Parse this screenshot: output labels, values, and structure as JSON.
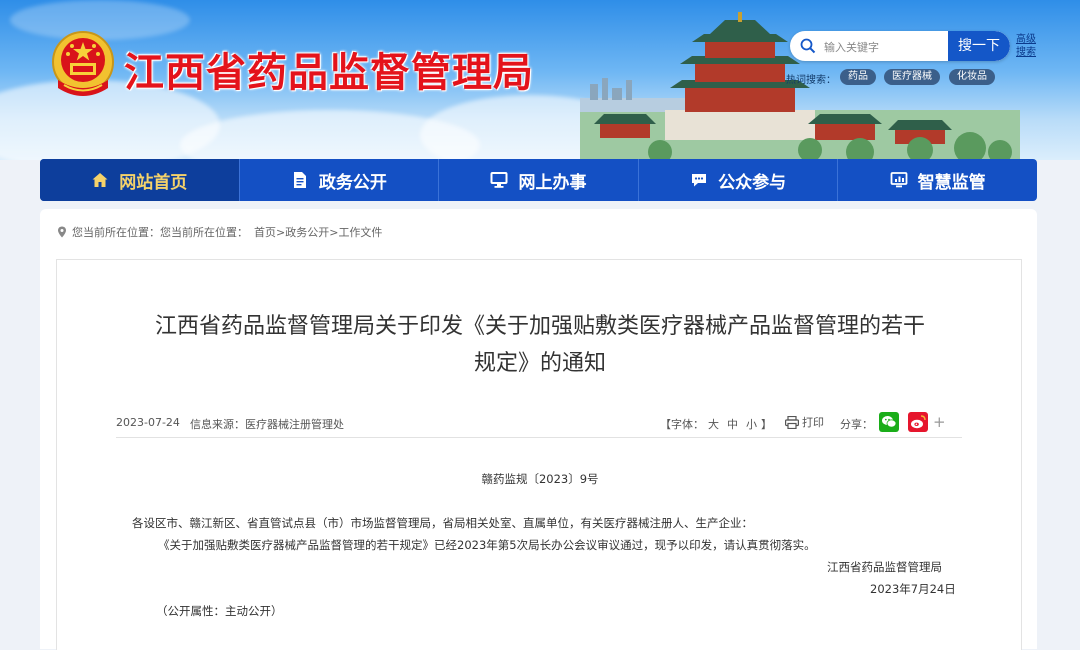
{
  "header": {
    "site_title": "江西省药品监督管理局",
    "search": {
      "placeholder": "输入关键字",
      "button_label": "搜一下",
      "advanced_label": "高级搜索"
    },
    "hot_search": {
      "label": "热词搜索：",
      "tags": [
        "药品",
        "医疗器械",
        "化妆品"
      ]
    }
  },
  "nav": {
    "items": [
      {
        "label": "网站首页",
        "icon": "home-icon"
      },
      {
        "label": "政务公开",
        "icon": "document-icon"
      },
      {
        "label": "网上办事",
        "icon": "monitor-icon"
      },
      {
        "label": "公众参与",
        "icon": "chat-icon"
      },
      {
        "label": "智慧监管",
        "icon": "chart-board-icon"
      }
    ],
    "active_index": 0
  },
  "breadcrumb": {
    "prefix": "您当前所在位置：",
    "text": "您当前所在位置：",
    "items": [
      "首页",
      "政务公开",
      "工作文件"
    ],
    "separator": ">"
  },
  "article": {
    "title_line1": "江西省药品监督管理局关于印发《关于加强贴敷类医疗器械产品监督管理的若干",
    "title_line2": "规定》的通知",
    "date": "2023-07-24",
    "source": "信息来源：医疗器械注册管理处",
    "font_size": {
      "prefix": "【字体：",
      "large": "大",
      "medium": "中",
      "small": "小",
      "suffix": "】"
    },
    "print_label": "打印",
    "share_label": "分享：",
    "doc_number": "赣药监规〔2023〕9号",
    "addressee": "各设区市、赣江新区、省直管试点县（市）市场监督管理局，省局相关处室、直属单位，有关医疗器械注册人、生产企业：",
    "body": "《关于加强贴敷类医疗器械产品监督管理的若干规定》已经2023年第5次局长办公会议审议通过，现予以印发，请认真贯彻落实。",
    "signature": "江西省药品监督管理局",
    "sign_date": "2023年7月24日",
    "disclosure": "（公开属性：主动公开）"
  },
  "colors": {
    "title_red": "#e4131b",
    "nav_blue": "#1450c4",
    "nav_active_text": "#f5d26a"
  }
}
